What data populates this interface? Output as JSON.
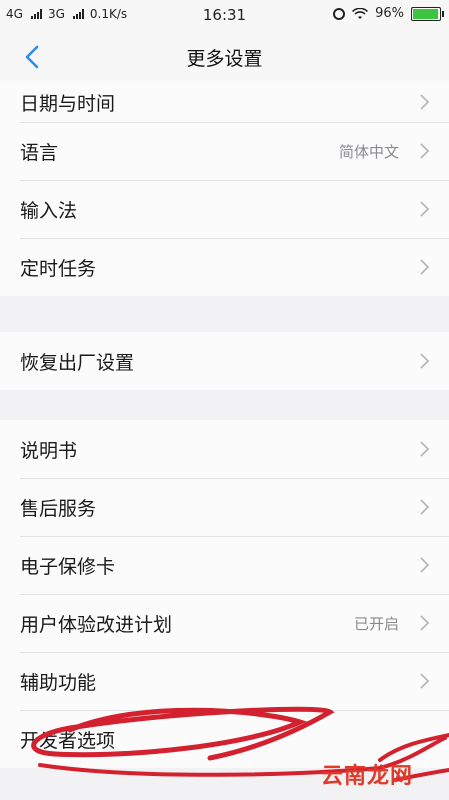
{
  "status_bar": {
    "network_1": "4G",
    "network_2": "3G",
    "speed": "0.1K/s",
    "time": "16:31",
    "battery": "96%",
    "battery_level": 0.96
  },
  "nav": {
    "title": "更多设置",
    "back_icon": "chevron-left-icon"
  },
  "groups": [
    {
      "items": [
        {
          "label": "日期与时间"
        },
        {
          "label": "语言",
          "value": "简体中文"
        },
        {
          "label": "输入法"
        },
        {
          "label": "定时任务"
        }
      ]
    },
    {
      "items": [
        {
          "label": "恢复出厂设置"
        }
      ]
    },
    {
      "items": [
        {
          "label": "说明书"
        },
        {
          "label": "售后服务"
        },
        {
          "label": "电子保修卡"
        },
        {
          "label": "用户体验改进计划",
          "value": "已开启"
        },
        {
          "label": "辅助功能"
        },
        {
          "label": "开发者选项"
        }
      ]
    }
  ],
  "watermark": "云南龙网",
  "colors": {
    "accent": "#2e8de6",
    "annotation": "#d4212f",
    "battery": "#3ec33e"
  }
}
